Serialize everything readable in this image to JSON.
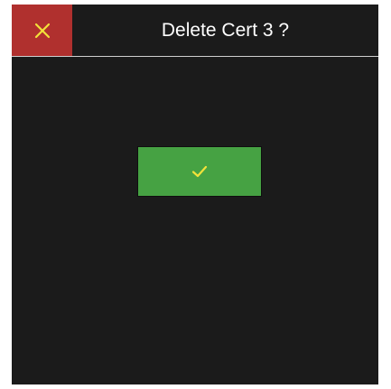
{
  "dialog": {
    "title": "Delete Cert 3 ?",
    "close_icon": "close-icon",
    "confirm_icon": "checkmark-icon"
  },
  "colors": {
    "background": "#1b1b1b",
    "close_button": "#b0302e",
    "confirm_button": "#46a243",
    "icon": "#f2e23a",
    "title_text": "#ffffff",
    "divider": "#cfcfcf"
  }
}
